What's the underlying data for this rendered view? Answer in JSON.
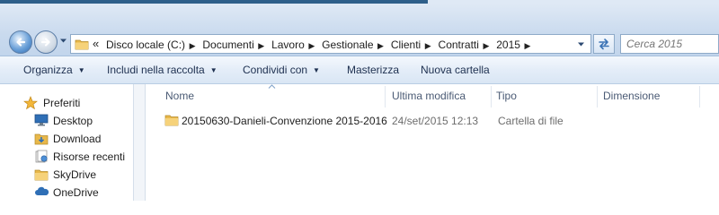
{
  "address": {
    "lead_glyph": "«",
    "crumbs": [
      "Disco locale (C:)",
      "Documenti",
      "Lavoro",
      "Gestionale",
      "Clienti",
      "Contratti",
      "2015"
    ]
  },
  "search": {
    "placeholder": "Cerca 2015"
  },
  "toolbar": {
    "organize": "Organizza",
    "include_library": "Includi nella raccolta",
    "share": "Condividi con",
    "burn": "Masterizza",
    "new_folder": "Nuova cartella"
  },
  "navigation": {
    "favorites_label": "Preferiti",
    "items": [
      {
        "label": "Desktop",
        "icon": "desktop-icon"
      },
      {
        "label": "Download",
        "icon": "download-folder-icon"
      },
      {
        "label": "Risorse recenti",
        "icon": "recent-places-icon"
      },
      {
        "label": "SkyDrive",
        "icon": "folder-icon"
      },
      {
        "label": "OneDrive",
        "icon": "cloud-icon"
      }
    ]
  },
  "columns": {
    "name": "Nome",
    "modified": "Ultima modifica",
    "type": "Tipo",
    "size": "Dimensione"
  },
  "files": [
    {
      "name": "20150630-Danieli-Convenzione 2015-2016",
      "modified": "24/set/2015 12:13",
      "type": "Cartella di file",
      "size": ""
    }
  ],
  "colors": {
    "folder": "#e8b84a",
    "accent": "#2e6bb3",
    "header_text": "#4a5a74",
    "meta_text": "#6d6d6d"
  }
}
